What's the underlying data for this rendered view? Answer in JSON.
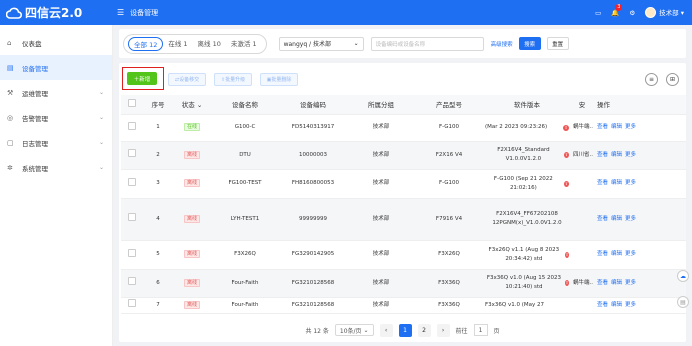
{
  "app": {
    "title": "四信云2.0",
    "breadcrumb": "设备管理"
  },
  "topbar": {
    "badge_count": "3",
    "user": "技术部"
  },
  "sidebar": {
    "items": [
      {
        "label": "仪表盘",
        "icon": "home-icon"
      },
      {
        "label": "设备管理",
        "icon": "device-icon"
      },
      {
        "label": "运维管理",
        "icon": "ops-icon"
      },
      {
        "label": "告警管理",
        "icon": "alarm-icon"
      },
      {
        "label": "日志管理",
        "icon": "log-icon"
      },
      {
        "label": "系统管理",
        "icon": "settings-icon"
      }
    ]
  },
  "filter": {
    "tabs": [
      "全部 12",
      "在线 1",
      "离线 10",
      "未激活 1"
    ],
    "org_select": "wangyq / 技术部",
    "search_placeholder": "设备编码或设备名称",
    "advanced": "高级搜索",
    "search_btn": "搜索",
    "reset_btn": "重置"
  },
  "toolbar": {
    "add": "新增",
    "b1": "设备移交",
    "b2": "批量升级",
    "b3": "批量删除"
  },
  "table": {
    "headers": [
      "序号",
      "状态",
      "设备名称",
      "设备编码",
      "所属分组",
      "产品型号",
      "软件版本",
      "安",
      "操作"
    ],
    "rows": [
      {
        "no": "1",
        "status": "在线",
        "name": "G100-C",
        "code": "FD5140313917",
        "group": "技术部",
        "model": "F-G100",
        "sw": "(Mar 2 2023 09:23:26)",
        "extra": "蜗牛端...",
        "ops": [
          "查看",
          "编辑",
          "更多"
        ]
      },
      {
        "no": "2",
        "status": "离线",
        "name": "DTU",
        "code": "10000003",
        "group": "技术部",
        "model": "F2X16 V4",
        "sw": "F2X16V4_Standard V1.0.0V1.2.0",
        "extra": "四川省...",
        "ops": [
          "查看",
          "编辑",
          "更多"
        ]
      },
      {
        "no": "3",
        "status": "离线",
        "name": "FG100-TEST",
        "code": "FH8160800053",
        "group": "技术部",
        "model": "F-G100",
        "sw": "F-G100 (Sep 21 2022 21:02:16)",
        "extra": "",
        "ops": [
          "查看",
          "编辑",
          "更多"
        ]
      },
      {
        "no": "4",
        "status": "离线",
        "name": "LYH-TEST1",
        "code": "99999999",
        "group": "技术部",
        "model": "F7916 V4",
        "sw": "F2X16V4_FF67202108 12PGNM(x)_V1.0.0V1.2.0",
        "extra": "",
        "ops": [
          "查看",
          "编辑",
          "更多"
        ]
      },
      {
        "no": "5",
        "status": "离线",
        "name": "F3X26Q",
        "code": "FG3290142905",
        "group": "技术部",
        "model": "F3X26Q",
        "sw": "F3x26Q v1.1 (Aug 8 2023 20:34:42) std",
        "extra": "",
        "ops": [
          "查看",
          "编辑",
          "更多"
        ]
      },
      {
        "no": "6",
        "status": "离线",
        "name": "Four-Faith",
        "code": "FG3210128568",
        "group": "技术部",
        "model": "F3X36Q",
        "sw": "F3x36Q v1.0 (Aug 15 2023 10:21:40) std",
        "extra": "蜗牛端...",
        "ops": [
          "查看",
          "编辑",
          "更多"
        ]
      },
      {
        "no": "7",
        "status": "离线",
        "name": "Four-Faith",
        "code": "FG3210128568",
        "group": "技术部",
        "model": "F3X36Q",
        "sw": "F3x36Q v1.0 (May 27",
        "extra": "",
        "ops": [
          "查看",
          "编辑",
          "更多"
        ]
      }
    ]
  },
  "pager": {
    "total": "共 12 条",
    "per_page": "10条/页",
    "pages": [
      "1",
      "2"
    ],
    "goto": "前往",
    "goto_value": "1",
    "page_unit": "页"
  },
  "colors": {
    "primary": "#1f6ff2",
    "add_green": "#52c41a",
    "highlight": "#e0201f"
  }
}
